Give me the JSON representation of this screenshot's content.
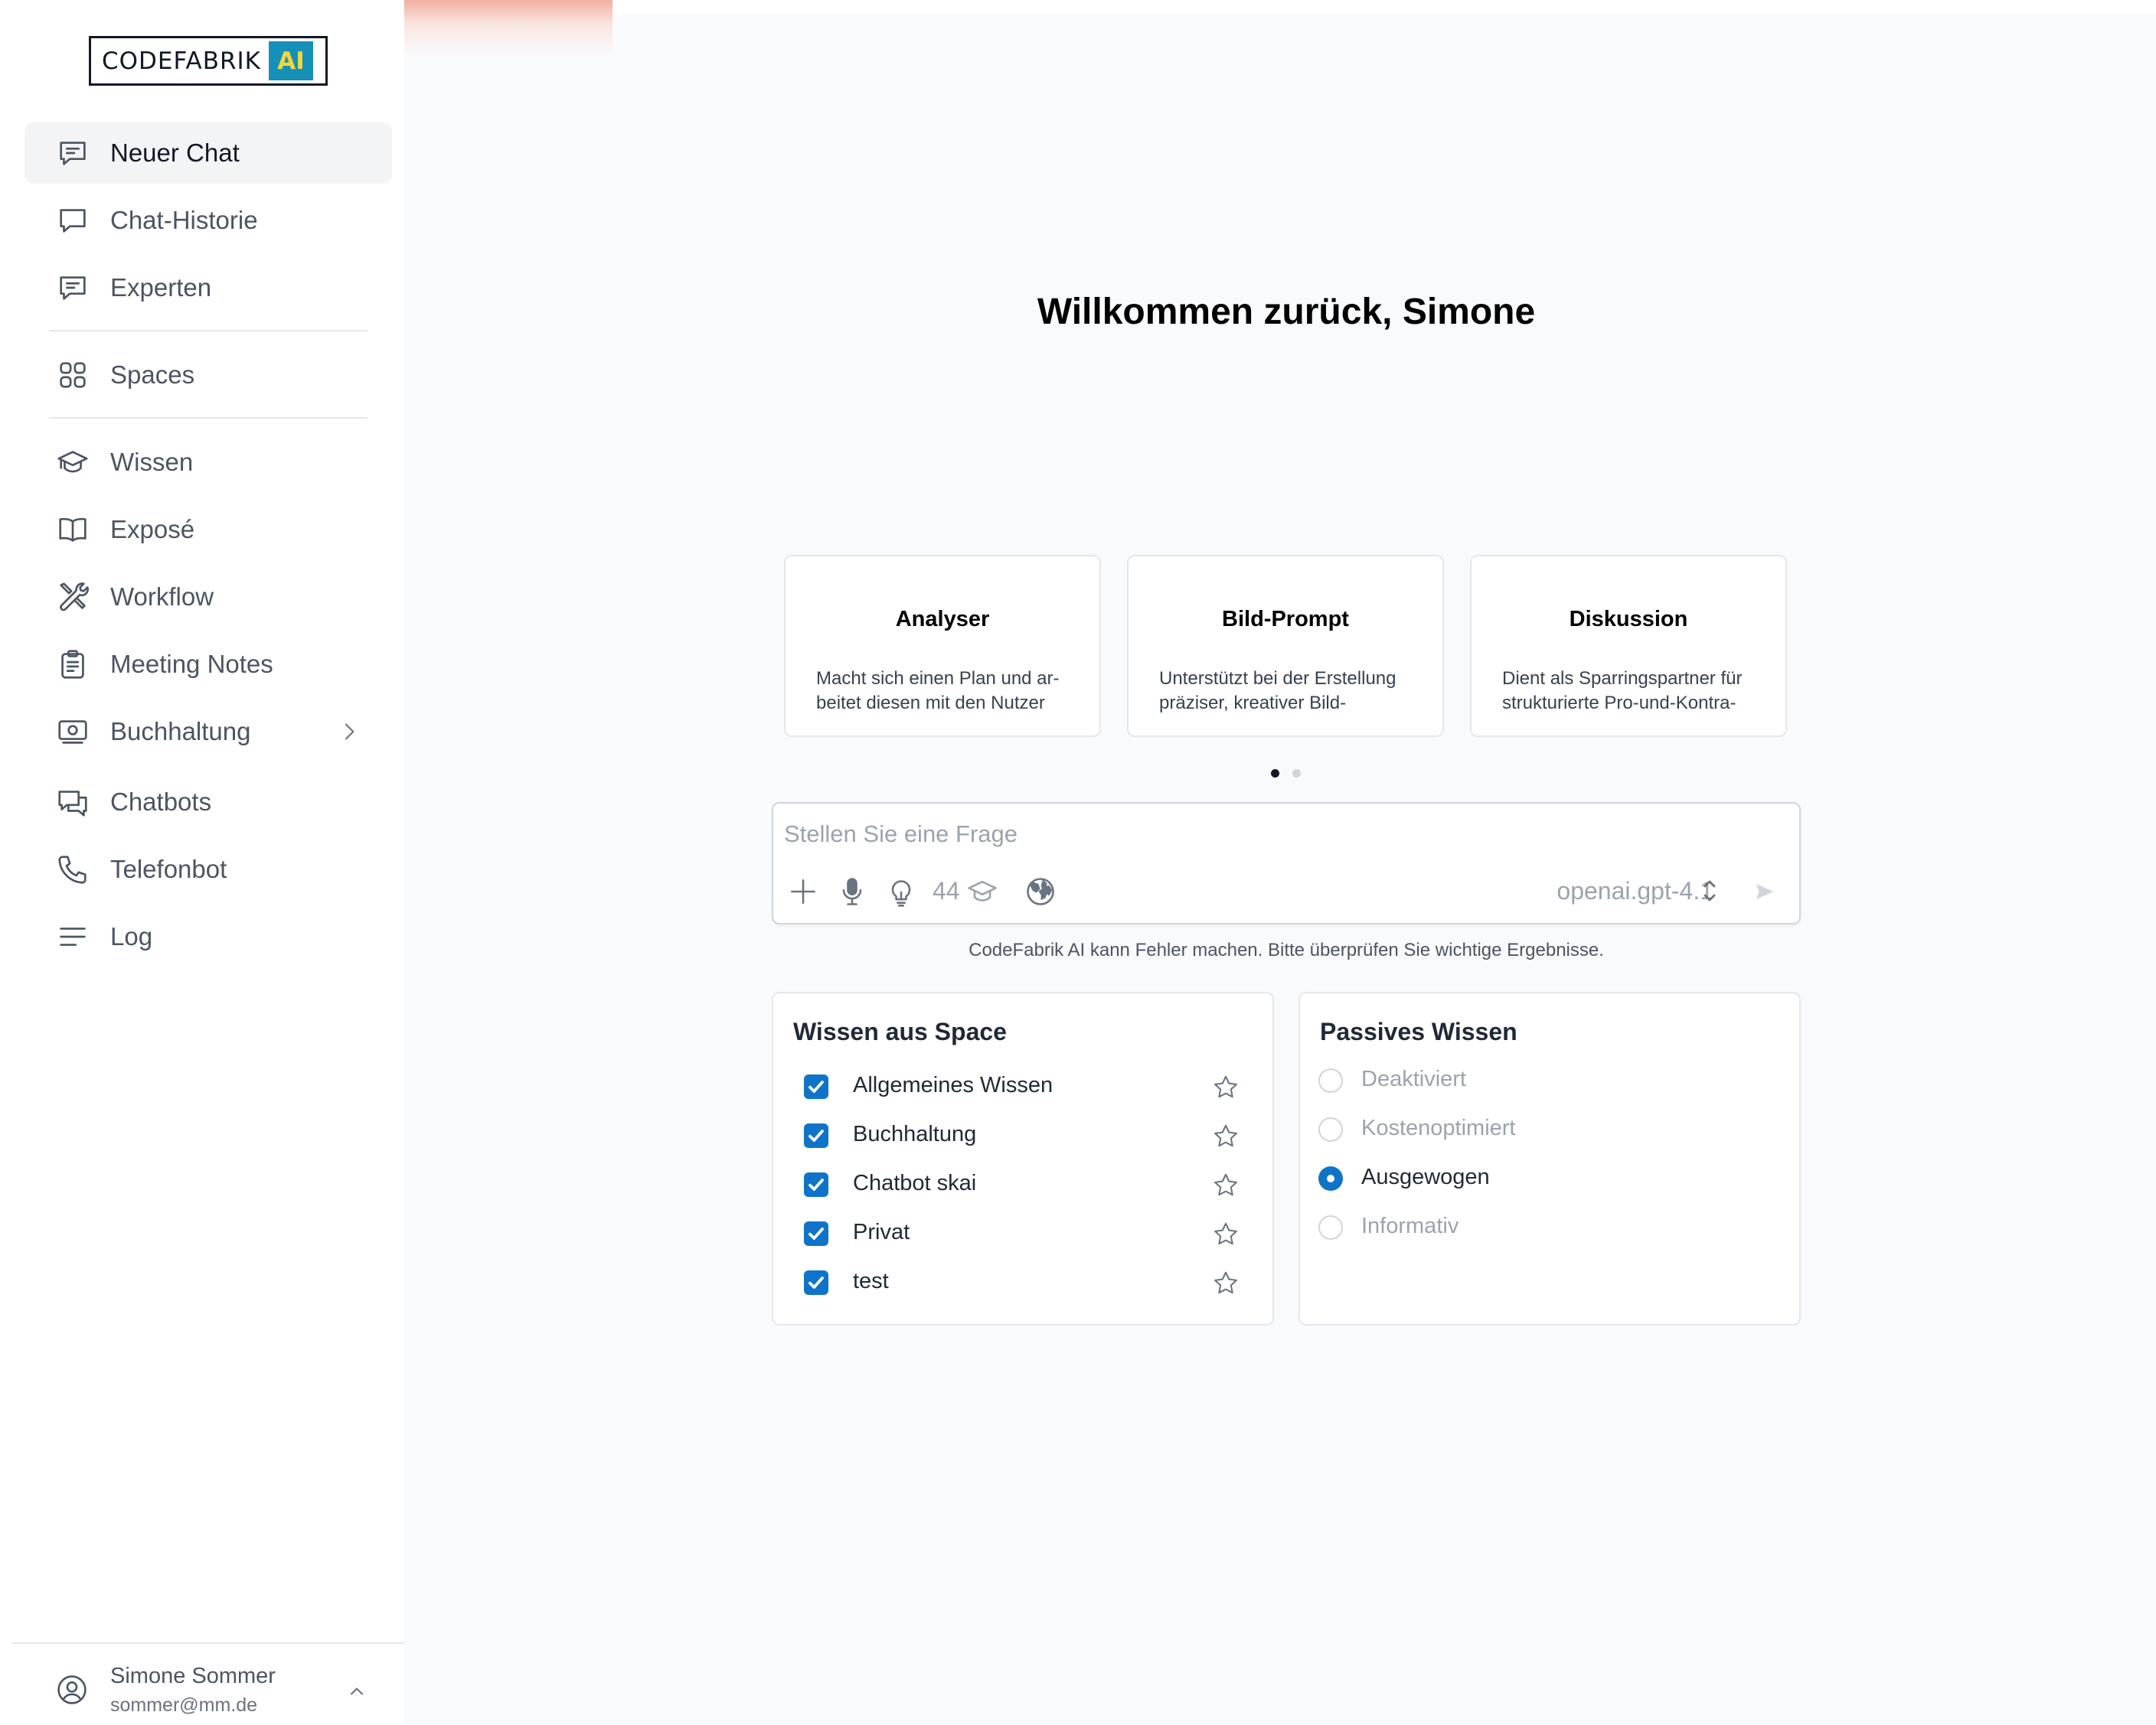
{
  "logo": {
    "text": "CODEFABRIK",
    "badge": "AI"
  },
  "nav": [
    {
      "label": "Neuer Chat",
      "icon": "chat-bubble-lines-icon",
      "active": true
    },
    {
      "label": "Chat-Historie",
      "icon": "chat-bubble-icon"
    },
    {
      "label": "Experten",
      "icon": "chat-bubble-lines-icon"
    },
    {
      "label": "Spaces",
      "icon": "grid-squares-icon"
    },
    {
      "label": "Wissen",
      "icon": "graduation-cap-icon"
    },
    {
      "label": "Exposé",
      "icon": "open-book-icon"
    },
    {
      "label": "Workflow",
      "icon": "tools-icon"
    },
    {
      "label": "Meeting Notes",
      "icon": "clipboard-icon"
    },
    {
      "label": "Buchhaltung",
      "icon": "cash-icon",
      "has_submenu": true
    },
    {
      "label": "Chatbots",
      "icon": "chat-bubbles-icon"
    },
    {
      "label": "Telefonbot",
      "icon": "phone-icon"
    },
    {
      "label": "Log",
      "icon": "lines-icon"
    }
  ],
  "user": {
    "name": "Simone Sommer",
    "email": "sommer@mm.de"
  },
  "welcome": "Willkommen zurück, Simone",
  "cards": [
    {
      "title": "Analyser",
      "desc": "Macht sich einen Plan und ar-beitet diesen mit den Nutzer"
    },
    {
      "title": "Bild-Prompt",
      "desc": "Unterstützt bei der Erstellung präziser, kreativer Bild-"
    },
    {
      "title": "Diskussion",
      "desc": "Dient als Sparringspartner für strukturierte Pro-und-Kontra-"
    }
  ],
  "carousel": {
    "pages": 2,
    "active": 1
  },
  "chat": {
    "placeholder": "Stellen Sie eine Frage",
    "knowledge_count": "44",
    "model": "openai.gpt-4.1"
  },
  "disclaimer": "CodeFabrik AI kann Fehler machen. Bitte überprüfen Sie wichtige Ergebnisse.",
  "space_knowledge": {
    "title": "Wissen aus Space",
    "items": [
      {
        "label": "Allgemeines Wissen",
        "checked": true
      },
      {
        "label": "Buchhaltung",
        "checked": true
      },
      {
        "label": "Chatbot skai",
        "checked": true
      },
      {
        "label": "Privat",
        "checked": true
      },
      {
        "label": "test",
        "checked": true
      }
    ]
  },
  "passive_knowledge": {
    "title": "Passives Wissen",
    "options": [
      {
        "label": "Deaktiviert",
        "selected": false
      },
      {
        "label": "Kostenoptimiert",
        "selected": false
      },
      {
        "label": "Ausgewogen",
        "selected": true
      },
      {
        "label": "Informativ",
        "selected": false
      }
    ]
  },
  "colors": {
    "accent": "#0f74c9",
    "logo_badge": "#1590b8",
    "logo_badge_text": "#f4d63a"
  }
}
